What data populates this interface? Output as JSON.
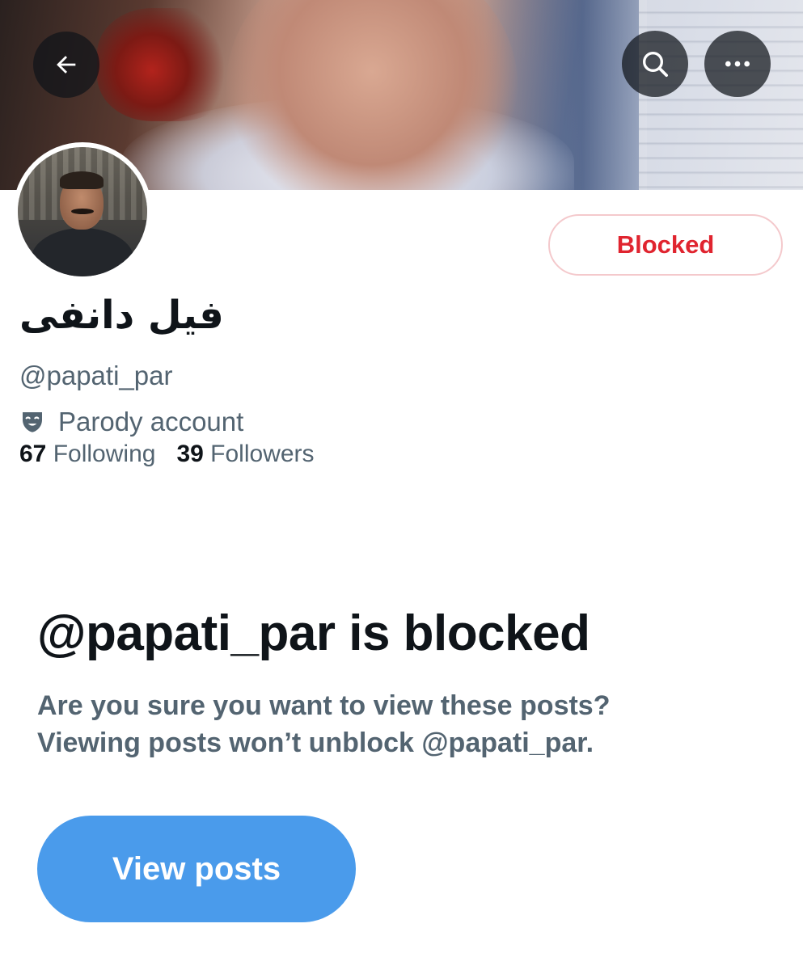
{
  "header": {
    "back_icon": "arrow-left-icon",
    "search_icon": "search-icon",
    "more_icon": "ellipsis-icon"
  },
  "profile": {
    "display_name": "فیل دانفی",
    "handle": "@papati_par",
    "relationship_button": "Blocked",
    "label_icon": "parody-mask-icon",
    "label": "Parody account",
    "following_count": "67",
    "following_label": "Following",
    "followers_count": "39",
    "followers_label": "Followers"
  },
  "blocked_notice": {
    "title": "@papati_par is blocked",
    "line1": "Are you sure you want to view these posts?",
    "line2": "Viewing posts won’t unblock @papati_par.",
    "button_label": "View posts"
  },
  "colors": {
    "blocked_red": "#e0242f",
    "secondary_text": "#536471",
    "primary_text": "#0f1419",
    "button_blue": "#4a9beb"
  }
}
